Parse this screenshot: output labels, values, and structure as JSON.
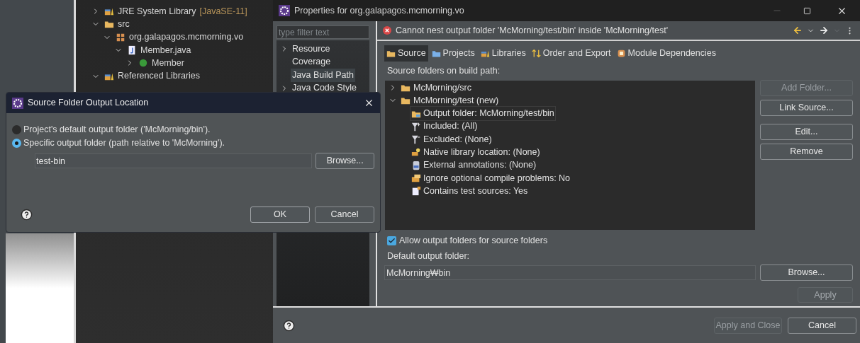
{
  "explorer": {
    "items": [
      {
        "label": "JRE System Library",
        "decoration": "[JavaSE-11]",
        "kind": "library",
        "expanded": false
      },
      {
        "label": "src",
        "kind": "source-folder",
        "expanded": true,
        "children": [
          {
            "label": "org.galapagos.mcmorning.vo",
            "kind": "package",
            "expanded": true,
            "children": [
              {
                "label": "Member.java",
                "kind": "java-file",
                "expanded": true,
                "children": [
                  {
                    "label": "Member",
                    "kind": "class",
                    "expanded": false
                  }
                ]
              }
            ]
          }
        ]
      },
      {
        "label": "Referenced Libraries",
        "kind": "library",
        "expanded": true
      }
    ]
  },
  "properties": {
    "title": "Properties for org.galapagos.mcmorning.vo",
    "filter_placeholder": "type filter text",
    "nav": [
      {
        "label": "Resource",
        "expandable": true,
        "selected": false
      },
      {
        "label": "Coverage",
        "expandable": false,
        "selected": false
      },
      {
        "label": "Java Build Path",
        "expandable": false,
        "selected": true
      },
      {
        "label": "Java Code Style",
        "expandable": true,
        "selected": false
      }
    ],
    "message": "Cannot nest output folder 'McMorning/test/bin' inside 'McMorning/test'",
    "tabs": [
      {
        "label": "Source",
        "kind": "source",
        "selected": true
      },
      {
        "label": "Projects",
        "kind": "projects",
        "selected": false
      },
      {
        "label": "Libraries",
        "kind": "libraries",
        "selected": false
      },
      {
        "label": "Order and Export",
        "kind": "order",
        "selected": false
      },
      {
        "label": "Module Dependencies",
        "kind": "module",
        "selected": false
      }
    ],
    "source_label": "Source folders on build path:",
    "source_tree": [
      {
        "label": "McMorning/src",
        "expanded": false
      },
      {
        "label": "McMorning/test (new)",
        "expanded": true,
        "children": [
          {
            "label": "Output folder: McMorning/test/bin",
            "kind": "output",
            "selected": true
          },
          {
            "label": "Included: (All)",
            "kind": "included",
            "selected": false
          },
          {
            "label": "Excluded: (None)",
            "kind": "excluded",
            "selected": false
          },
          {
            "label": "Native library location: (None)",
            "kind": "native",
            "selected": false
          },
          {
            "label": "External annotations: (None)",
            "kind": "annotations",
            "selected": false
          },
          {
            "label": "Ignore optional compile problems: No",
            "kind": "ignore",
            "selected": false
          },
          {
            "label": "Contains test sources: Yes",
            "kind": "test",
            "selected": false
          }
        ]
      }
    ],
    "side_buttons": [
      {
        "label": "Add Folder...",
        "disabled": true
      },
      {
        "label": "Link Source...",
        "disabled": false
      },
      {
        "label": "Edit...",
        "disabled": false
      },
      {
        "label": "Remove",
        "disabled": false
      }
    ],
    "allow_checkbox": {
      "label": "Allow output folders for source folders",
      "checked": true
    },
    "default_output_label": "Default output folder:",
    "default_output_value": "McMorning₩bin",
    "browse": "Browse...",
    "apply": {
      "label": "Apply",
      "disabled": true
    },
    "apply_and_close": {
      "label": "Apply and Close",
      "disabled": true
    },
    "cancel": "Cancel"
  },
  "dialog": {
    "title": "Source Folder Output Location",
    "options": [
      {
        "label": "Project's default output folder ('McMorning/bin').",
        "selected": false
      },
      {
        "label": "Specific output folder (path relative to 'McMorning').",
        "selected": true
      }
    ],
    "field_value": "test-bin",
    "browse": "Browse...",
    "ok": "OK",
    "cancel": "Cancel"
  }
}
